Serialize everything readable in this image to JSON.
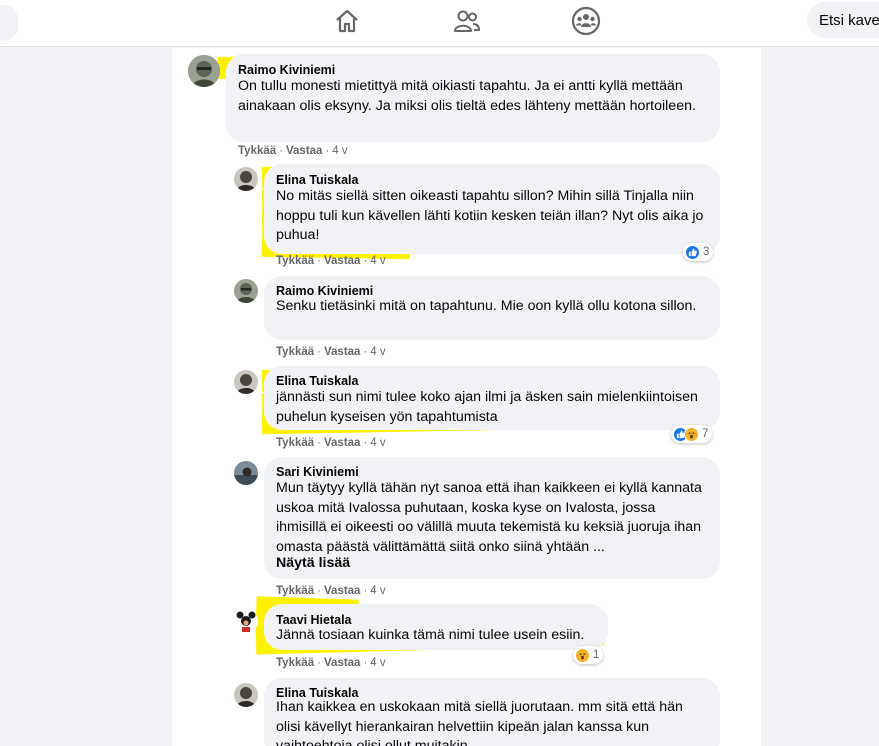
{
  "topbar": {
    "home_icon": "home-icon",
    "friends_icon": "friends-icon",
    "groups_icon": "groups-icon",
    "search_placeholder": "Etsi kave"
  },
  "comments": [
    {
      "author": "Raimo Kiviniemi",
      "text": "On tullu monesti mietittyä mitä oikiasti tapahtu. Ja ei antti kyllä mettään ainakaan olis eksyny. Ja miksi olis tieltä edes lähteny mettään hortoileen.",
      "like_label": "Tykkää",
      "reply_label": "Vastaa",
      "age": "4 v"
    },
    {
      "author": "Elina Tuiskala",
      "text": "No mitäs siellä sitten oikeasti tapahtu sillon? Mihin sillä Tinjalla niin hoppu tuli kun kävellen lähti kotiin kesken teiän illan? Nyt olis aika jo puhua!",
      "like_label": "Tykkää",
      "reply_label": "Vastaa",
      "age": "4 v",
      "reaction_count": "3"
    },
    {
      "author": "Raimo Kiviniemi",
      "text": "Senku tietäsinki mitä on tapahtunu. Mie oon kyllä ollu kotona sillon.",
      "like_label": "Tykkää",
      "reply_label": "Vastaa",
      "age": "4 v"
    },
    {
      "author": "Elina Tuiskala",
      "text": "jännästi sun nimi tulee koko ajan ilmi ja äsken sain mielenkiintoisen puhelun kyseisen yön tapahtumista",
      "like_label": "Tykkää",
      "reply_label": "Vastaa",
      "age": "4 v",
      "reaction_count": "7"
    },
    {
      "author": "Sari Kiviniemi",
      "text": "Mun täytyy kyllä tähän nyt sanoa että ihan kaikkeen ei kyllä kannata uskoa mitä Ivalossa puhutaan, koska kyse on Ivalosta, jossa ihmisillä ei oikeesti oo välillä muuta tekemistä ku keksiä juoruja ihan omasta päästä välittämättä siitä onko siinä yhtään ...",
      "see_more": "Näytä lisää",
      "like_label": "Tykkää",
      "reply_label": "Vastaa",
      "age": "4 v"
    },
    {
      "author": "Taavi Hietala",
      "text": "Jännä tosiaan kuinka tämä nimi tulee usein esiin.",
      "like_label": "Tykkää",
      "reply_label": "Vastaa",
      "age": "4 v",
      "reaction_count": "1"
    },
    {
      "author": "Elina Tuiskala",
      "text": "Ihan kaikkea en uskokaan mitä siellä juorutaan. mm sitä että hän olisi kävellyt hierankairan helvettiin kipeän jalan kanssa kun vaihtoehtoja olisi ollut muitakin"
    }
  ],
  "colors": {
    "highlight": "#fff200",
    "bubble": "#f0f2f5",
    "like_blue": "#1877f2",
    "wow_yellow": "#f7b125",
    "meta_gray": "#65676b"
  }
}
